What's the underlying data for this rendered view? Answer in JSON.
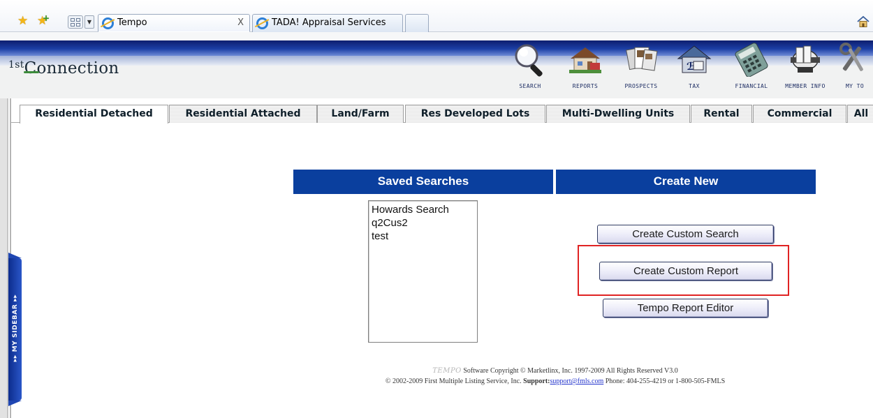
{
  "browser": {
    "tabs": [
      {
        "title": "Tempo",
        "close": "X"
      },
      {
        "title": "TADA! Appraisal Services"
      }
    ]
  },
  "app": {
    "logo": {
      "sup": "1st",
      "rest": "Connection"
    },
    "nav": [
      {
        "label": "SEARCH",
        "icon": "magnifier-icon"
      },
      {
        "label": "REPORTS",
        "icon": "house-reports-icon"
      },
      {
        "label": "PROSPECTS",
        "icon": "documents-icon"
      },
      {
        "label": "TAX",
        "icon": "house-tax-icon"
      },
      {
        "label": "FINANCIAL",
        "icon": "calculator-icon"
      },
      {
        "label": "MEMBER INFO",
        "icon": "rolodex-icon"
      },
      {
        "label": "MY TO",
        "icon": "tools-icon"
      }
    ]
  },
  "sidebar": {
    "label": "▸▸  MY SIDEBAR  ▸▸"
  },
  "property_tabs": [
    {
      "label": "Residential Detached",
      "active": true
    },
    {
      "label": "Residential Attached"
    },
    {
      "label": "Land/Farm"
    },
    {
      "label": "Res Developed Lots"
    },
    {
      "label": "Multi-Dwelling Units"
    },
    {
      "label": "Rental"
    },
    {
      "label": "Commercial"
    },
    {
      "label": "All"
    }
  ],
  "saved_searches": {
    "header": "Saved Searches",
    "items": [
      "Howards Search",
      "q2Cus2",
      "test"
    ]
  },
  "create_new": {
    "header": "Create New",
    "buttons": {
      "custom_search": "Create Custom Search",
      "custom_report": "Create Custom Report",
      "report_editor": "Tempo Report Editor"
    }
  },
  "footer": {
    "tempo_logo": "TEMPO",
    "copyright": "Software Copyright © Marketlinx, Inc. 1997-2009 All Rights Reserved V3.0",
    "line2_prefix": "© 2002-2009 First Multiple Listing Service, Inc.",
    "support_label": "Support:",
    "support_email": "support@fmls.com",
    "phone": "Phone: 404-255-4219 or 1-800-505-FMLS"
  },
  "colors": {
    "header_blue": "#0a3f9e",
    "highlight_red": "#e02323",
    "nav_band": "#1c3fa5"
  }
}
